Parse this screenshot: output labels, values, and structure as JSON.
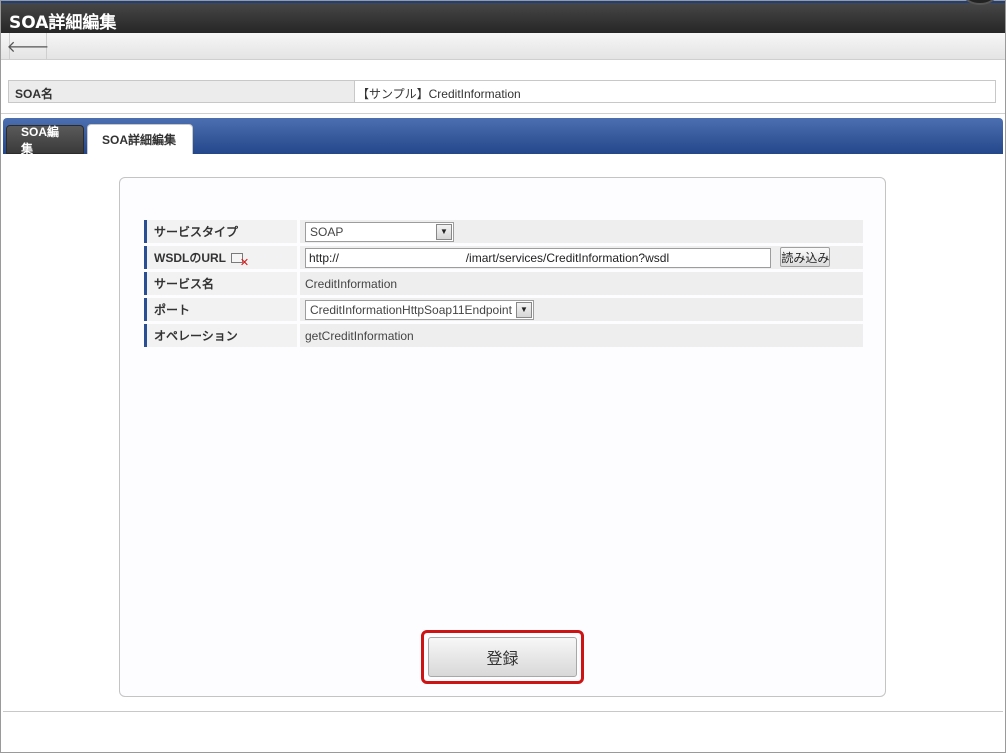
{
  "window": {
    "title": "SOA詳細編集"
  },
  "toolbar": {
    "back_icon": "arrow-left-icon",
    "back_glyph": "🡐"
  },
  "soa_name": {
    "label": "SOA名",
    "value": "【サンプル】CreditInformation"
  },
  "tabs": [
    {
      "label": "SOA編集",
      "active": false
    },
    {
      "label": "SOA詳細編集",
      "active": true
    }
  ],
  "form": {
    "service_type": {
      "label": "サービスタイプ",
      "value": "SOAP"
    },
    "wsdl_url": {
      "label": "WSDLのURL",
      "value": "http://                                      /imart/services/CreditInformation?wsdl",
      "load_button": "読み込み"
    },
    "service_name": {
      "label": "サービス名",
      "value": "CreditInformation"
    },
    "port": {
      "label": "ポート",
      "value": "CreditInformationHttpSoap11Endpoint"
    },
    "operation": {
      "label": "オペレーション",
      "value": "getCreditInformation"
    }
  },
  "actions": {
    "register": "登録"
  },
  "colors": {
    "tab_bar": "#2f56a0",
    "highlight": "#cc1414",
    "label_accent": "#2a4e93"
  }
}
